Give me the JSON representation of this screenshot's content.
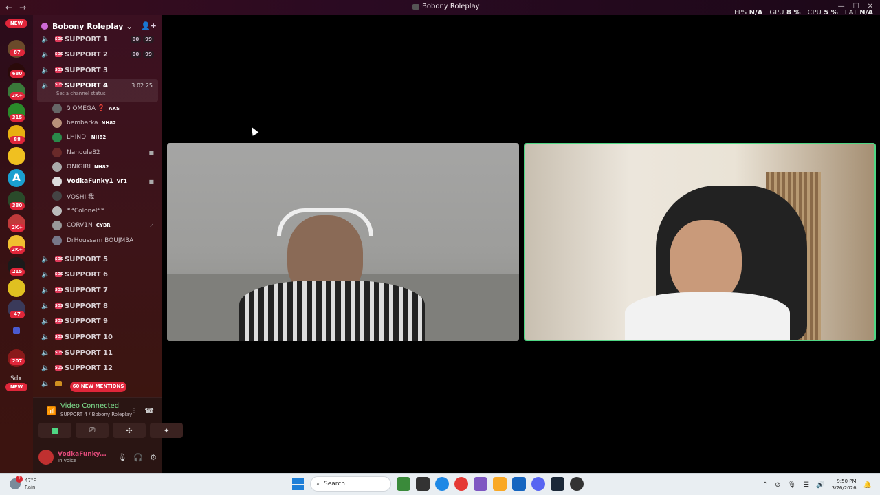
{
  "window": {
    "title": "Bobony Roleplay",
    "back": "←",
    "forward": "→"
  },
  "hud": {
    "fps_label": "FPS",
    "fps_value": "N/A",
    "gpu_label": "GPU",
    "gpu_value": "8 %",
    "cpu_label": "CPU",
    "cpu_value": "5 %",
    "lat_label": "LAT",
    "lat_value": "N/A"
  },
  "server_rail": {
    "new_top": "NEW",
    "new_bottom": "NEW",
    "text_server": "Sdx",
    "letter_server": "A",
    "badges": [
      "87",
      "680",
      "2K+",
      "315",
      "88",
      "380",
      "2K+",
      "2K+",
      "215",
      "47",
      "207"
    ]
  },
  "guild": {
    "name": "Bobony Roleplay"
  },
  "channels": [
    {
      "name": "SUPPORT 1",
      "counts": [
        "00",
        "99"
      ]
    },
    {
      "name": "SUPPORT 2",
      "counts": [
        "00",
        "99"
      ]
    },
    {
      "name": "SUPPORT 3"
    },
    {
      "name": "SUPPORT 4",
      "timer": "3:02:25",
      "status": "Set a channel status"
    },
    {
      "name": "SUPPORT 5"
    },
    {
      "name": "SUPPORT 6"
    },
    {
      "name": "SUPPORT 7"
    },
    {
      "name": "SUPPORT 8"
    },
    {
      "name": "SUPPORT 9"
    },
    {
      "name": "SUPPORT 10"
    },
    {
      "name": "SUPPORT 11"
    },
    {
      "name": "SUPPORT 12"
    }
  ],
  "voice_users": [
    {
      "name": "𝕴 OMEGA ❓",
      "tag": "AKS"
    },
    {
      "name": "bembarka",
      "tag": "NH82"
    },
    {
      "name": "LHINDI",
      "tag": "NH82"
    },
    {
      "name": "Nahoule82",
      "tag": ""
    },
    {
      "name": "ONIGIRI",
      "tag": "NH82"
    },
    {
      "name": "VodkaFunky1",
      "tag": "VF1"
    },
    {
      "name": "VOSHI 我",
      "tag": ""
    },
    {
      "name": "⁴⁰⁴Colonel⁴⁰⁴",
      "tag": ""
    },
    {
      "name": "CORV1N",
      "tag": "CYBR"
    },
    {
      "name": "DrHoussam BOUJM3A",
      "tag": ""
    }
  ],
  "mentions_pill": "60 NEW MENTIONS",
  "voice_panel": {
    "title": "Video Connected",
    "subtitle": "SUPPORT 4 / Bobony Roleplay"
  },
  "user_panel": {
    "name": "VodkaFunky...",
    "status": "In voice"
  },
  "taskbar": {
    "temp": "47°F",
    "weather": "Rain",
    "weather_alerts": "7",
    "search_placeholder": "Search",
    "time": "9:50 PM",
    "date": "3/26/2026"
  }
}
